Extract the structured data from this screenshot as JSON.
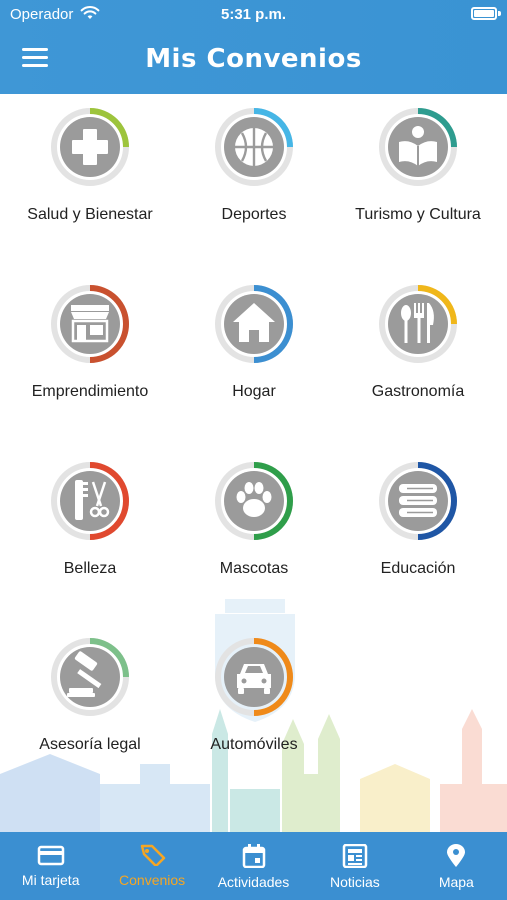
{
  "status": {
    "carrier": "Operador",
    "time": "5:31 p.m."
  },
  "header": {
    "title": "Mis Convenios"
  },
  "categories": [
    {
      "label": "Salud y Bienestar",
      "icon": "cross-icon",
      "ring_color": "#9dc43c"
    },
    {
      "label": "Deportes",
      "icon": "basketball-icon",
      "ring_color": "#46b6e6"
    },
    {
      "label": "Turismo y Cultura",
      "icon": "book-reader-icon",
      "ring_color": "#2e9c8f"
    },
    {
      "label": "Emprendimiento",
      "icon": "storefront-icon",
      "ring_color": "#c9512f"
    },
    {
      "label": "Hogar",
      "icon": "house-icon",
      "ring_color": "#3c8fd1"
    },
    {
      "label": "Gastronomía",
      "icon": "cutlery-icon",
      "ring_color": "#f0b71a"
    },
    {
      "label": "Belleza",
      "icon": "comb-scissors-icon",
      "ring_color": "#e0492f"
    },
    {
      "label": "Mascotas",
      "icon": "paw-icon",
      "ring_color": "#2f9e4a"
    },
    {
      "label": "Educación",
      "icon": "books-stack-icon",
      "ring_color": "#1f56a5"
    },
    {
      "label": "Asesoría legal",
      "icon": "gavel-icon",
      "ring_color": "#7dc08a"
    },
    {
      "label": "Automóviles",
      "icon": "car-icon",
      "ring_color": "#ef8a1a"
    }
  ],
  "tabs": [
    {
      "label": "Mi tarjeta",
      "icon": "card-icon",
      "active": false
    },
    {
      "label": "Convenios",
      "icon": "tag-icon",
      "active": true
    },
    {
      "label": "Actividades",
      "icon": "calendar-icon",
      "active": false
    },
    {
      "label": "Noticias",
      "icon": "newspaper-icon",
      "active": false
    },
    {
      "label": "Mapa",
      "icon": "map-pin-icon",
      "active": false
    }
  ],
  "colors": {
    "header": "#3f97d6",
    "tabbar": "#3b8fd1",
    "tab_active": "#f5a623",
    "icon_fill": "#9b9b9b",
    "ring_track": "#e3e3e3"
  }
}
